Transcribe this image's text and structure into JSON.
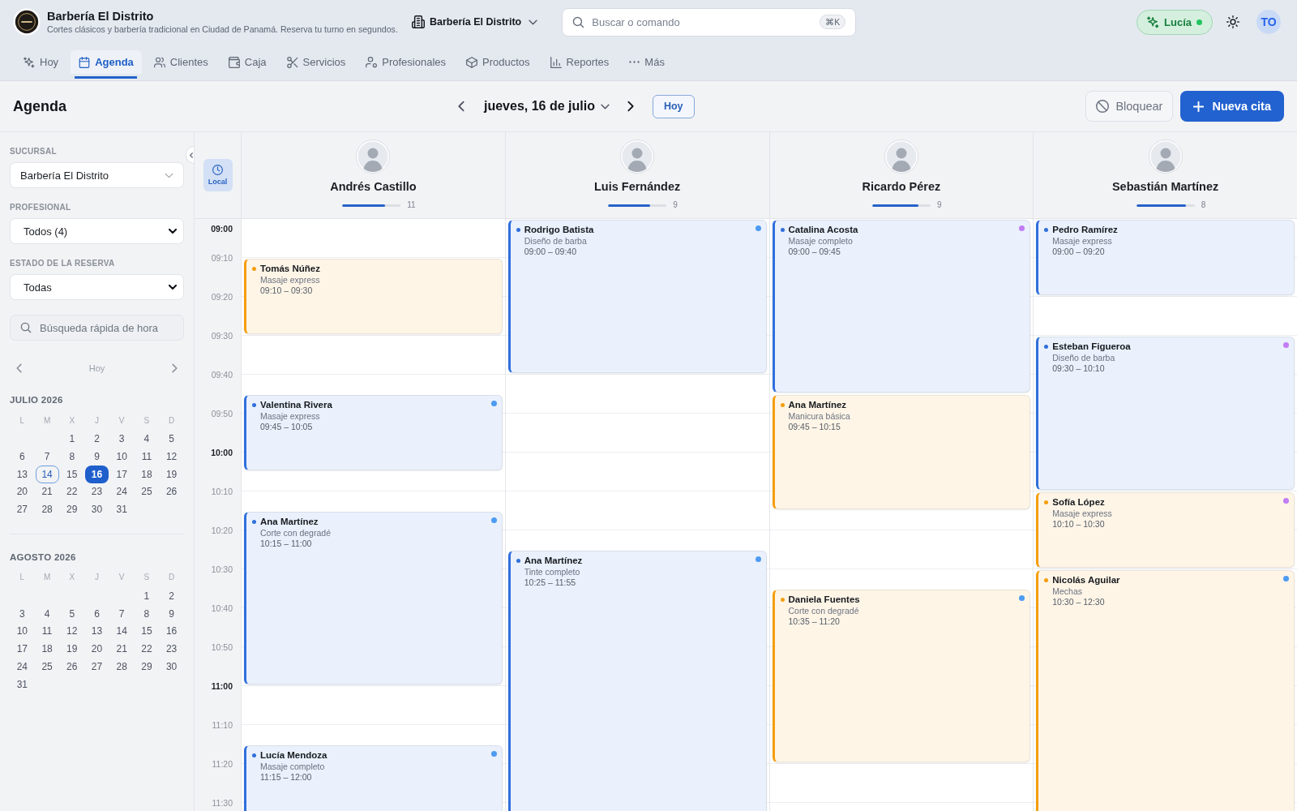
{
  "header": {
    "brand": {
      "title": "Barbería El Distrito",
      "subtitle": "Cortes clásicos y barbería tradicional en Ciudad de Panamá. Reserva tu turno en segundos."
    },
    "location_selector": {
      "label": "Barbería El Distrito"
    },
    "search": {
      "placeholder": "Buscar o comando",
      "shortcut": "⌘K"
    },
    "assistant": {
      "label": "Lucía",
      "online": true
    },
    "user": {
      "initials": "TO"
    }
  },
  "nav_tabs": [
    {
      "label": "Hoy",
      "selected": false
    },
    {
      "label": "Agenda",
      "selected": true
    },
    {
      "label": "Clientes",
      "selected": false
    },
    {
      "label": "Caja",
      "selected": false
    },
    {
      "label": "Servicios",
      "selected": false
    },
    {
      "label": "Profesionales",
      "selected": false
    },
    {
      "label": "Productos",
      "selected": false
    },
    {
      "label": "Reportes",
      "selected": false
    },
    {
      "label": "Más",
      "selected": false
    }
  ],
  "toolbar": {
    "title": "Agenda",
    "date": "jueves, 16 de julio",
    "today_button": "Hoy",
    "block_button": "Bloquear",
    "new_button": "Nueva cita"
  },
  "sidebar": {
    "filters": [
      {
        "label": "SUCURSAL",
        "value": "Barbería El Distrito",
        "kind": "custom"
      },
      {
        "label": "PROFESIONAL",
        "value": "Todos (4)",
        "kind": "native"
      },
      {
        "label": "ESTADO DE LA RESERVA",
        "value": "Todas",
        "kind": "native"
      }
    ],
    "time_search": {
      "placeholder": "Búsqueda rápida de hora"
    },
    "month_nav": {
      "today": "Hoy"
    },
    "months": [
      {
        "title": "JULIO 2026",
        "weekdays": [
          "L",
          "M",
          "X",
          "J",
          "V",
          "S",
          "D"
        ],
        "weeks": [
          [
            {
              "label": "1",
              "selected": false,
              "today": false
            },
            {
              "label": "2",
              "selected": false,
              "today": false
            },
            {
              "label": "3",
              "selected": false,
              "today": false
            },
            {
              "label": "4",
              "selected": false,
              "today": false
            },
            {
              "label": "5",
              "selected": false,
              "today": false
            }
          ],
          [
            {
              "label": "6",
              "selected": false,
              "today": false
            },
            {
              "label": "7",
              "selected": false,
              "today": false
            },
            {
              "label": "8",
              "selected": false,
              "today": false
            },
            {
              "label": "9",
              "selected": false,
              "today": false
            },
            {
              "label": "10",
              "selected": false,
              "today": false
            },
            {
              "label": "11",
              "selected": false,
              "today": false
            },
            {
              "label": "12",
              "selected": false,
              "today": false
            }
          ],
          [
            {
              "label": "13",
              "selected": false,
              "today": false
            },
            {
              "label": "14",
              "selected": false,
              "today": true
            },
            {
              "label": "15",
              "selected": false,
              "today": false
            },
            {
              "label": "16",
              "selected": true,
              "today": false
            },
            {
              "label": "17",
              "selected": false,
              "today": false
            },
            {
              "label": "18",
              "selected": false,
              "today": false
            },
            {
              "label": "19",
              "selected": false,
              "today": false
            }
          ],
          [
            {
              "label": "20",
              "selected": false,
              "today": false
            },
            {
              "label": "21",
              "selected": false,
              "today": false
            },
            {
              "label": "22",
              "selected": false,
              "today": false
            },
            {
              "label": "23",
              "selected": false,
              "today": false
            },
            {
              "label": "24",
              "selected": false,
              "today": false
            },
            {
              "label": "25",
              "selected": false,
              "today": false
            },
            {
              "label": "26",
              "selected": false,
              "today": false
            }
          ],
          [
            {
              "label": "27",
              "selected": false,
              "today": false
            },
            {
              "label": "28",
              "selected": false,
              "today": false
            },
            {
              "label": "29",
              "selected": false,
              "today": false
            },
            {
              "label": "30",
              "selected": false,
              "today": false
            },
            {
              "label": "31",
              "selected": false,
              "today": false
            }
          ]
        ]
      },
      {
        "title": "AGOSTO 2026",
        "weekdays": [
          "L",
          "M",
          "X",
          "J",
          "V",
          "S",
          "D"
        ],
        "weeks": [
          [
            {
              "label": "1",
              "selected": false,
              "today": false
            },
            {
              "label": "2",
              "selected": false,
              "today": false
            }
          ],
          [
            {
              "label": "3",
              "selected": false,
              "today": false
            },
            {
              "label": "4",
              "selected": false,
              "today": false
            },
            {
              "label": "5",
              "selected": false,
              "today": false
            },
            {
              "label": "6",
              "selected": false,
              "today": false
            },
            {
              "label": "7",
              "selected": false,
              "today": false
            },
            {
              "label": "8",
              "selected": false,
              "today": false
            },
            {
              "label": "9",
              "selected": false,
              "today": false
            }
          ],
          [
            {
              "label": "10",
              "selected": false,
              "today": false
            },
            {
              "label": "11",
              "selected": false,
              "today": false
            },
            {
              "label": "12",
              "selected": false,
              "today": false
            },
            {
              "label": "13",
              "selected": false,
              "today": false
            },
            {
              "label": "14",
              "selected": false,
              "today": false
            },
            {
              "label": "15",
              "selected": false,
              "today": false
            },
            {
              "label": "16",
              "selected": false,
              "today": false
            }
          ],
          [
            {
              "label": "17",
              "selected": false,
              "today": false
            },
            {
              "label": "18",
              "selected": false,
              "today": false
            },
            {
              "label": "19",
              "selected": false,
              "today": false
            },
            {
              "label": "20",
              "selected": false,
              "today": false
            },
            {
              "label": "21",
              "selected": false,
              "today": false
            },
            {
              "label": "22",
              "selected": false,
              "today": false
            },
            {
              "label": "23",
              "selected": false,
              "today": false
            }
          ],
          [
            {
              "label": "24",
              "selected": false,
              "today": false
            },
            {
              "label": "25",
              "selected": false,
              "today": false
            },
            {
              "label": "26",
              "selected": false,
              "today": false
            },
            {
              "label": "27",
              "selected": false,
              "today": false
            },
            {
              "label": "28",
              "selected": false,
              "today": false
            },
            {
              "label": "29",
              "selected": false,
              "today": false
            },
            {
              "label": "30",
              "selected": false,
              "today": false
            }
          ],
          [
            {
              "label": "31",
              "selected": false,
              "today": false
            }
          ]
        ]
      }
    ]
  },
  "calendar": {
    "timezone_toggle": {
      "label": "Local",
      "on": true
    },
    "times": [
      {
        "label": "09:00",
        "kind": "hour"
      },
      {
        "label": "09:10",
        "kind": "minute"
      },
      {
        "label": "09:20",
        "kind": "minute"
      },
      {
        "label": "09:30",
        "kind": "minute"
      },
      {
        "label": "09:40",
        "kind": "minute"
      },
      {
        "label": "09:50",
        "kind": "minute"
      },
      {
        "label": "10:00",
        "kind": "hour"
      },
      {
        "label": "10:10",
        "kind": "minute"
      },
      {
        "label": "10:20",
        "kind": "minute"
      },
      {
        "label": "10:30",
        "kind": "minute"
      },
      {
        "label": "10:40",
        "kind": "minute"
      },
      {
        "label": "10:50",
        "kind": "minute"
      },
      {
        "label": "11:00",
        "kind": "hour"
      },
      {
        "label": "11:10",
        "kind": "minute"
      },
      {
        "label": "11:20",
        "kind": "minute"
      },
      {
        "label": "11:30",
        "kind": "minute"
      }
    ],
    "staff": [
      {
        "name": "Andrés Castillo",
        "level": 0.74,
        "count": "11",
        "events": [
          {
            "client": "Tomás Núñez",
            "service": "Masaje express",
            "time": "09:10 – 09:30",
            "color": "#f59e0b"
          },
          {
            "client": "Valentina Rivera",
            "service": "Masaje express",
            "time": "09:45 – 10:05",
            "color": "#2f6fdc",
            "marker": {
              "color": "#4d9bf2"
            }
          },
          {
            "client": "Ana Martínez",
            "service": "Corte con degradé",
            "time": "10:15 – 11:00",
            "color": "#2f6fdc",
            "marker": {
              "color": "#4d9bf2"
            }
          },
          {
            "client": "Lucía Mendoza",
            "service": "Masaje completo",
            "time": "11:15 – 12:00",
            "color": "#2f6fdc",
            "marker": {
              "color": "#4d9bf2"
            }
          }
        ]
      },
      {
        "name": "Luis Fernández",
        "level": 0.72,
        "count": "9",
        "events": [
          {
            "client": "Rodrigo Batista",
            "service": "Diseño de barba",
            "time": "09:00 – 09:40",
            "color": "#2f6fdc",
            "marker": {
              "color": "#4d9bf2"
            }
          },
          {
            "client": "Ana Martínez",
            "service": "Tinte completo",
            "time": "10:25 – 11:55",
            "color": "#2f6fdc",
            "marker": {
              "color": "#4d9bf2"
            }
          }
        ]
      },
      {
        "name": "Ricardo Pérez",
        "level": 0.79,
        "count": "9",
        "events": [
          {
            "client": "Catalina Acosta",
            "service": "Masaje completo",
            "time": "09:00 – 09:45",
            "color": "#2f6fdc",
            "marker": {
              "color": "#c27cf5"
            }
          },
          {
            "client": "Ana Martínez",
            "service": "Manicura básica",
            "time": "09:45 – 10:15",
            "color": "#f59e0b"
          },
          {
            "client": "Daniela Fuentes",
            "service": "Corte con degradé",
            "time": "10:35 – 11:20",
            "color": "#f59e0b",
            "marker": {
              "color": "#4d9bf2"
            }
          }
        ]
      },
      {
        "name": "Sebastián Martínez",
        "level": 0.85,
        "count": "8",
        "events": [
          {
            "client": "Pedro Ramírez",
            "service": "Masaje express",
            "time": "09:00 – 09:20",
            "color": "#2f6fdc"
          },
          {
            "client": "Esteban Figueroa",
            "service": "Diseño de barba",
            "time": "09:30 – 10:10",
            "color": "#2f6fdc",
            "marker": {
              "color": "#c27cf5"
            }
          },
          {
            "client": "Sofía López",
            "service": "Masaje express",
            "time": "10:10 – 10:30",
            "color": "#f59e0b",
            "marker": {
              "color": "#c27cf5"
            }
          },
          {
            "client": "Nicolás Aguilar",
            "service": "Mechas",
            "time": "10:30 – 12:30",
            "color": "#f59e0b",
            "marker": {
              "color": "#4d9bf2"
            }
          }
        ]
      }
    ]
  }
}
